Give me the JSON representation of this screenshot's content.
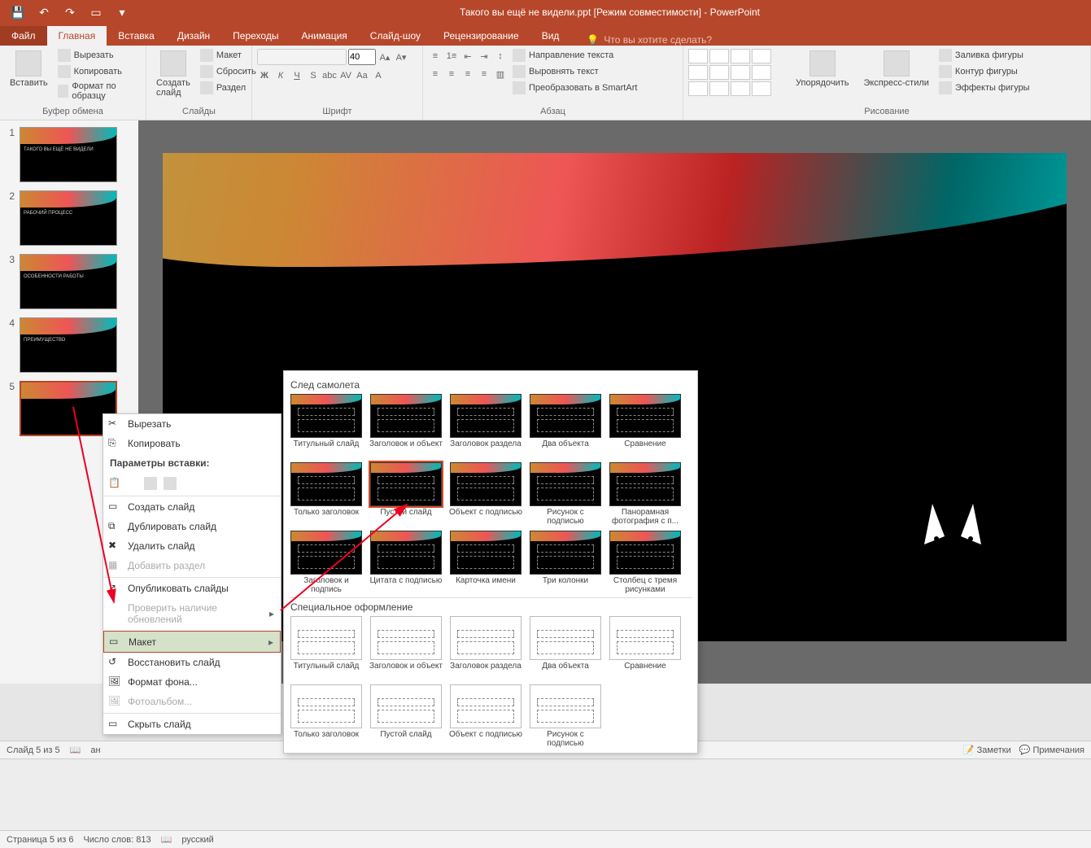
{
  "titlebar": {
    "title": "Такого вы ещё не видели.ppt [Режим совместимости] - PowerPoint"
  },
  "tabs": {
    "file": "Файл",
    "home": "Главная",
    "insert": "Вставка",
    "design": "Дизайн",
    "transitions": "Переходы",
    "animation": "Анимация",
    "slideshow": "Слайд-шоу",
    "review": "Рецензирование",
    "view": "Вид",
    "tellme": "Что вы хотите сделать?"
  },
  "ribbon": {
    "clipboard": {
      "paste": "Вставить",
      "cut": "Вырезать",
      "copy": "Копировать",
      "format_painter": "Формат по образцу",
      "label": "Буфер обмена"
    },
    "slides": {
      "new_slide": "Создать слайд",
      "layout": "Макет",
      "reset": "Сбросить",
      "section": "Раздел",
      "label": "Слайды"
    },
    "font": {
      "size": "40",
      "label": "Шрифт"
    },
    "paragraph": {
      "text_direction": "Направление текста",
      "align_text": "Выровнять текст",
      "smartart": "Преобразовать в SmartArt",
      "label": "Абзац"
    },
    "drawing": {
      "arrange": "Упорядочить",
      "quick_styles": "Экспресс-стили",
      "shape_fill": "Заливка фигуры",
      "shape_outline": "Контур фигуры",
      "shape_effects": "Эффекты фигуры",
      "label": "Рисование"
    }
  },
  "slides": [
    {
      "num": "1",
      "title": "ТАКОГО ВЫ ЕЩЁ НЕ ВИДЕЛИ"
    },
    {
      "num": "2",
      "title": "РАБОЧИЙ ПРОЦЕСС"
    },
    {
      "num": "3",
      "title": "ОСОБЕННОСТИ РАБОТЫ"
    },
    {
      "num": "4",
      "title": "ПРЕИМУЩЕСТВО"
    },
    {
      "num": "5",
      "title": ""
    }
  ],
  "context_menu": {
    "cut": "Вырезать",
    "copy": "Копировать",
    "paste_header": "Параметры вставки:",
    "new_slide": "Создать слайд",
    "duplicate": "Дублировать слайд",
    "delete": "Удалить слайд",
    "add_section": "Добавить раздел",
    "publish": "Опубликовать слайды",
    "check_updates": "Проверить наличие обновлений",
    "layout": "Макет",
    "reset": "Восстановить слайд",
    "format_bg": "Формат фона...",
    "photo_album": "Фотоальбом...",
    "hide": "Скрыть слайд"
  },
  "layout_flyout": {
    "section1": "След самолета",
    "items1": [
      "Титульный слайд",
      "Заголовок и объект",
      "Заголовок раздела",
      "Два объекта",
      "Сравнение",
      "Только заголовок",
      "Пустой слайд",
      "Объект с подписью",
      "Рисунок с подписью",
      "Панорамная фотография с п...",
      "Заголовок и подпись",
      "Цитата с подписью",
      "Карточка имени",
      "Три колонки",
      "Столбец с тремя рисунками"
    ],
    "section2": "Специальное оформление",
    "items2": [
      "Титульный слайд",
      "Заголовок и объект",
      "Заголовок раздела",
      "Два объекта",
      "Сравнение",
      "Только заголовок",
      "Пустой слайд",
      "Объект с подписью",
      "Рисунок с подписью"
    ],
    "selected_index": 6
  },
  "status1": {
    "slide": "Слайд 5 из 5",
    "lang_short": "ан",
    "notes": "Заметки",
    "comments": "Примечания"
  },
  "status2": {
    "page": "Страница 5 из 6",
    "words": "Число слов: 813",
    "lang": "русский"
  }
}
